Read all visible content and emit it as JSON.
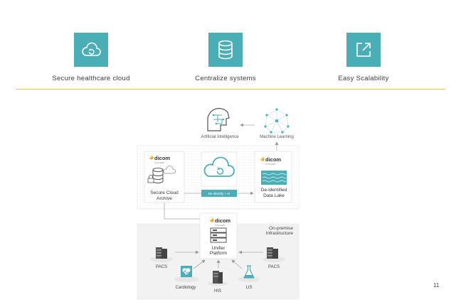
{
  "features": [
    {
      "label": "Secure healthcare cloud",
      "icon": "cloud-sync-icon"
    },
    {
      "label": "Centralize systems",
      "icon": "database-icon"
    },
    {
      "label": "Easy Scalability",
      "icon": "expand-icon"
    }
  ],
  "diagram": {
    "ai_label": "Artificial Intelligence",
    "ml_label": "Machine Learning",
    "brand": "dicom",
    "brand_sub": "SYSTEMS",
    "archive_label_1": "Secure Cloud",
    "archive_label_2": "Archive",
    "connector_label": "De-identify + AI",
    "lake_label_1": "De-identified",
    "lake_label_2": "Data Lake",
    "onprem_label_1": "On-premise",
    "onprem_label_2": "Infrastructure",
    "platform_label_1": "Unifier",
    "platform_label_2": "Platform",
    "nodes": [
      "PACS",
      "Cardiology",
      "HIS",
      "LIS",
      "PACS"
    ]
  },
  "colors": {
    "accent": "#4aaeb6",
    "rule": "#e8c25a",
    "brand_orange": "#f5a623"
  },
  "page_number": "11"
}
